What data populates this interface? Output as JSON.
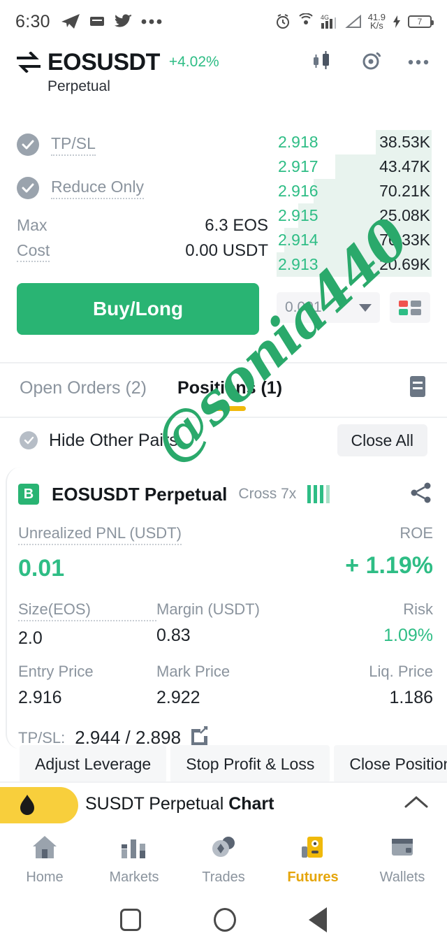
{
  "status_bar": {
    "time": "6:30",
    "left_icons": [
      "telegram-icon",
      "message-icon",
      "twitter-icon",
      "more-dots-icon"
    ],
    "right_icons": [
      "alarm-icon",
      "hotspot-icon",
      "signal-4g-icon",
      "signal-triangle-icon"
    ],
    "network_speed_value": "41.9",
    "network_speed_unit": "K/s",
    "battery_level": "7"
  },
  "header": {
    "pair": "EOSUSDT",
    "change": "+4.02%",
    "subtitle": "Perpetual",
    "icons": [
      "candlestick-chart-icon",
      "alert-icon",
      "more-options-icon"
    ]
  },
  "order_form": {
    "tpsl_label": "TP/SL",
    "reduce_only_label": "Reduce Only",
    "max_label": "Max",
    "max_value": "6.3 EOS",
    "cost_label": "Cost",
    "cost_value": "0.00 USDT",
    "buy_button": "Buy/Long"
  },
  "order_book": {
    "rows": [
      {
        "price": "2.918",
        "amount": "38.53K",
        "depth": 36
      },
      {
        "price": "2.917",
        "amount": "43.47K",
        "depth": 62
      },
      {
        "price": "2.916",
        "amount": "70.21K",
        "depth": 76
      },
      {
        "price": "2.915",
        "amount": "25.08K",
        "depth": 86
      },
      {
        "price": "2.914",
        "amount": "76.33K",
        "depth": 95
      },
      {
        "price": "2.913",
        "amount": "20.69K",
        "depth": 100
      }
    ],
    "tick_size": "0.001",
    "depth_mode_icon": "order-book-mode-icon"
  },
  "tabs": {
    "open_orders": "Open Orders (2)",
    "positions": "Positions (1)",
    "doc_icon": "document-icon"
  },
  "sub_bar": {
    "hide_other_pairs": "Hide Other Pairs",
    "close_all": "Close All"
  },
  "position": {
    "badge": "B",
    "title": "EOSUSDT Perpetual",
    "margin_mode": "Cross 7x",
    "pnl_label": "Unrealized PNL (USDT)",
    "pnl_value": "0.01",
    "roe_label": "ROE",
    "roe_value": "+ 1.19%",
    "size_label": "Size(EOS)",
    "size_value": "2.0",
    "margin_label": "Margin (USDT)",
    "margin_value": "0.83",
    "risk_label": "Risk",
    "risk_value": "1.09%",
    "entry_label": "Entry Price",
    "entry_value": "2.916",
    "mark_label": "Mark Price",
    "mark_value": "2.922",
    "liq_label": "Liq. Price",
    "liq_value": "1.186",
    "tpsl_label": "TP/SL:",
    "tpsl_value": "2.944 / 2.898",
    "actions": [
      "Adjust Leverage",
      "Stop Profit & Loss",
      "Close Position"
    ]
  },
  "chart_drawer": {
    "title": "SUSDT Perpetual",
    "subtitle": "Chart",
    "flame_icon": "flame-icon",
    "chevron": "chevron-up-icon"
  },
  "bottom_nav": [
    {
      "label": "Home",
      "icon": "home-icon",
      "active": false
    },
    {
      "label": "Markets",
      "icon": "markets-bar-icon",
      "active": false
    },
    {
      "label": "Trades",
      "icon": "trades-coins-icon",
      "active": false
    },
    {
      "label": "Futures",
      "icon": "futures-icon",
      "active": true
    },
    {
      "label": "Wallets",
      "icon": "wallet-card-icon",
      "active": false
    }
  ],
  "system_nav": [
    "recents-square-icon",
    "home-circle-icon",
    "back-triangle-icon"
  ],
  "watermark": "@sonia440",
  "colors": {
    "green": "#2ebd85",
    "buy_green": "#29b473",
    "accent_yellow": "#f0b90b",
    "text_dark": "#1e2329",
    "text_gray": "#8b949e"
  }
}
